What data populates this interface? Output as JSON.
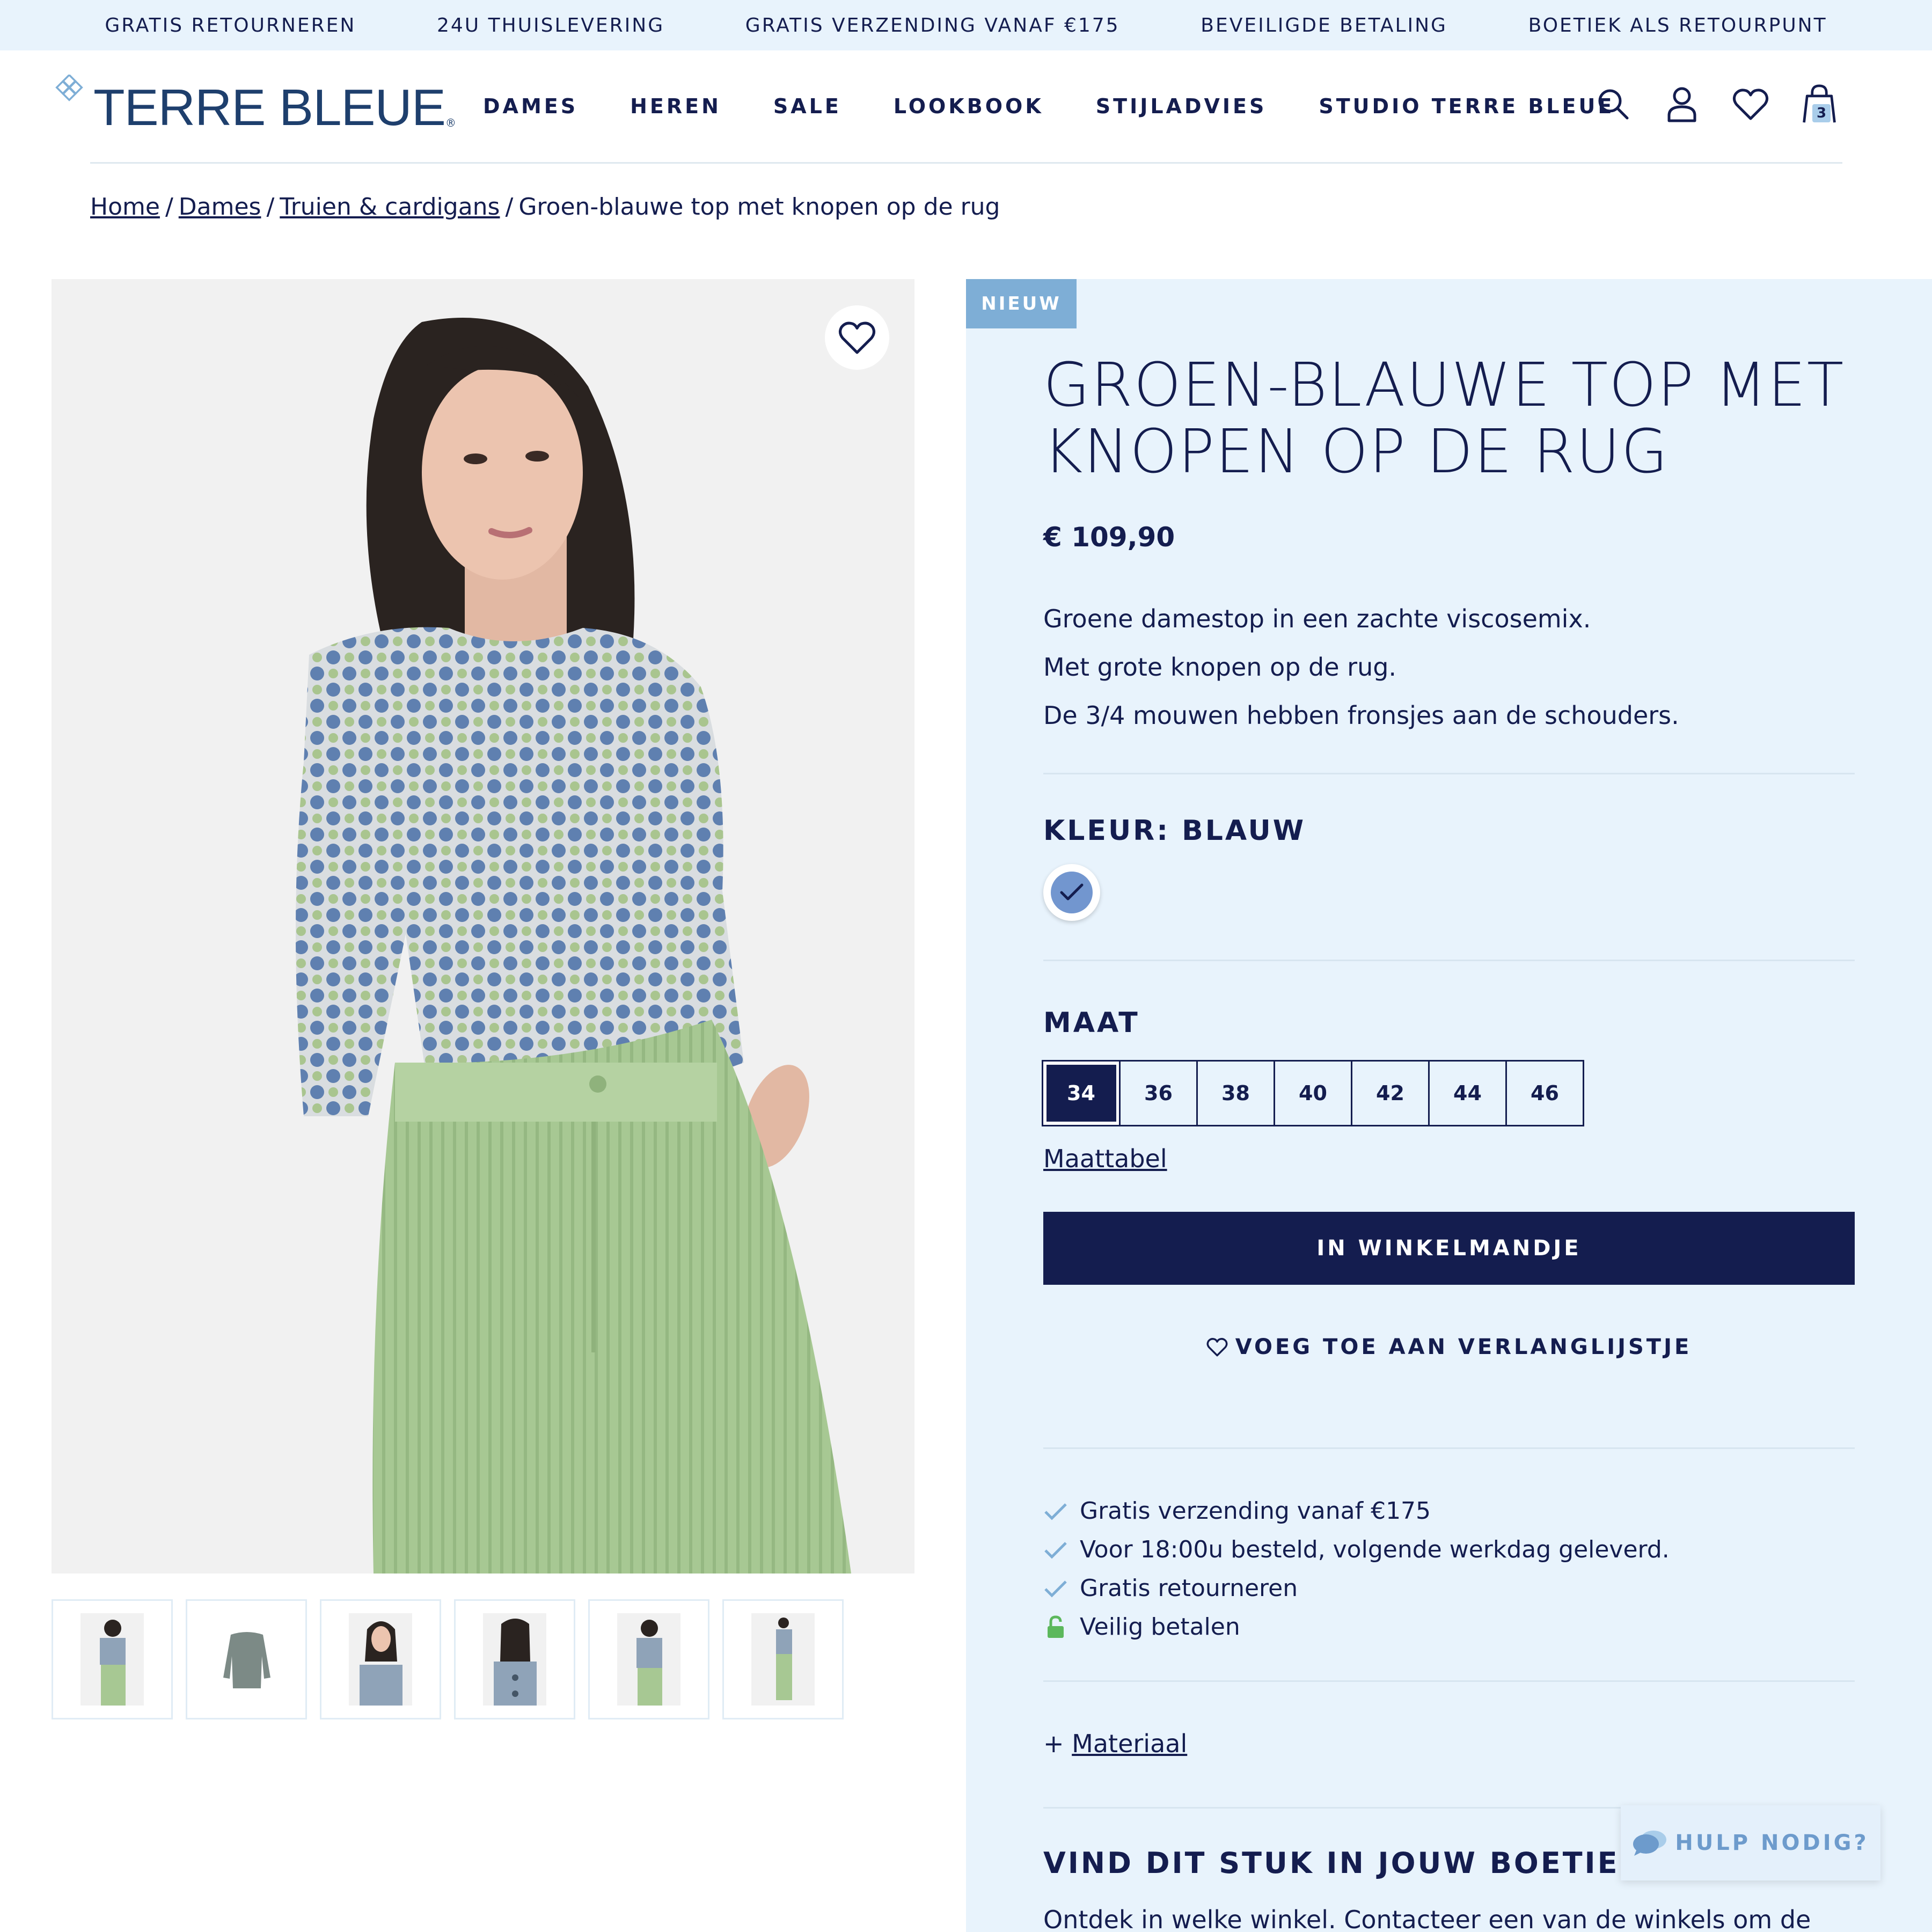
{
  "promo": [
    "GRATIS RETOURNEREN",
    "24U THUISLEVERING",
    "GRATIS VERZENDING VANAF €175",
    "BEVEILIGDE BETALING",
    "BOETIEK ALS RETOURPUNT"
  ],
  "brand": {
    "name": "TERRE BLEUE",
    "reg": "®",
    "color": "#1e3f6d"
  },
  "nav": [
    "DAMES",
    "HEREN",
    "SALE",
    "LOOKBOOK",
    "STIJLADVIES",
    "STUDIO TERRE BLEUE"
  ],
  "header_icons": [
    "search-icon",
    "account-icon",
    "heart-icon",
    "bag-icon"
  ],
  "cart_count": "3",
  "breadcrumb": {
    "home": "Home",
    "dames": "Dames",
    "category": "Truien & cardigans",
    "current": "Groen-blauwe top met knopen op de rug",
    "sep": "/"
  },
  "product": {
    "badge": "NIEUW",
    "title": "GROEN-BLAUWE TOP MET KNOPEN OP DE RUG",
    "price": "€ 109,90",
    "description": [
      "Groene damestop in een zachte viscosemix.",
      "Met grote knopen op de rug.",
      "De 3/4 mouwen hebben fronsjes aan de schouders."
    ],
    "color_label": "KLEUR: BLAUW",
    "color_swatch": "#7296cf",
    "size_label": "MAAT",
    "sizes": [
      "34",
      "36",
      "38",
      "40",
      "42",
      "44",
      "46"
    ],
    "selected_size": "34",
    "size_chart": "Maattabel",
    "add_to_cart": "IN WINKELMANDJE",
    "wishlist": "VOEG TOE AAN VERLANGLIJSTJE",
    "usps": [
      "Gratis verzending vanaf €175",
      "Voor 18:00u besteld, volgende werkdag geleverd.",
      "Gratis retourneren",
      "Veilig betalen"
    ],
    "material_prefix": "+",
    "material": "Materiaal",
    "find_title": "VIND DIT STUK IN JOUW BOETIEK",
    "find_text": "Ontdek in welke winkel. Contacteer een van de winkels om de"
  },
  "help": "HULP NODIG?",
  "colors": {
    "navy": "#141d4f",
    "panel": "#e8f3fc",
    "badge": "#7eaed6",
    "accent": "#6d9bcc",
    "check": "#7eaed6",
    "lock": "#5cb85c"
  }
}
